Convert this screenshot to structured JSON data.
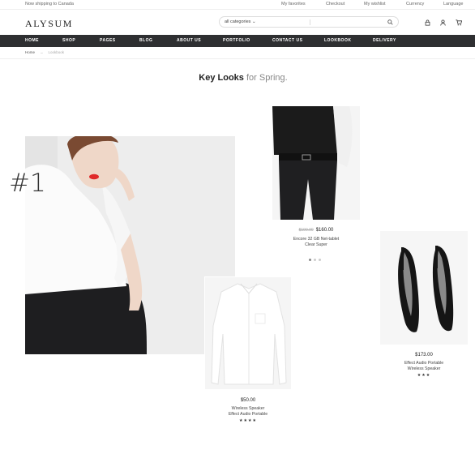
{
  "topbar": {
    "shipping": "Now shipping to Canada",
    "links": [
      "My favorites",
      "Checkout",
      "My wishlist",
      "Currency",
      "Language"
    ]
  },
  "header": {
    "logo": "ALYSUM",
    "search_category": "all categories",
    "search_placeholder": ""
  },
  "nav": [
    "HOME",
    "SHOP",
    "PAGES",
    "BLOG",
    "ABOUT US",
    "PORTFOLIO",
    "CONTACT US",
    "LOOKBOOK",
    "DELIVERY"
  ],
  "breadcrumb": {
    "home": "Home",
    "separator": "→",
    "current": "Lookbook"
  },
  "page": {
    "title_bold": "Key Looks",
    "title_light": "for Spring.",
    "look_number": "#1"
  },
  "products": [
    {
      "old_price": "$190.00",
      "price": "$160.00",
      "name1": "Encore 32 GB Net-tablet",
      "name2": "Clear Super"
    },
    {
      "price": "$173.00",
      "name1": "Effect Audio Portable",
      "name2": "Wireless Speaker",
      "stars": "★★★"
    },
    {
      "price": "$50.00",
      "name1": "Wireless Speaker",
      "name2": "Effect Audio Portable",
      "stars": "★★★★"
    }
  ],
  "colors": {
    "nav_bg": "#2e2f31",
    "accent_lips": "#e02a2a"
  }
}
